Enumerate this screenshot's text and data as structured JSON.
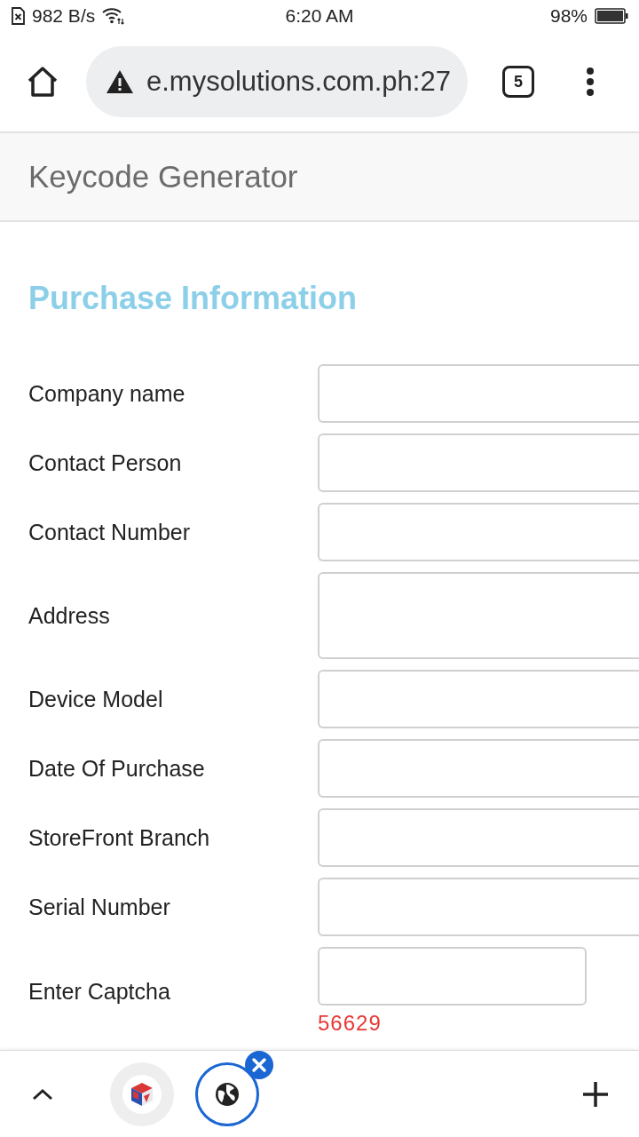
{
  "status_bar": {
    "network_speed": "982 B/s",
    "time": "6:20 AM",
    "battery": "98%"
  },
  "browser": {
    "url": "e.mysolutions.com.ph:27",
    "tab_count": "5"
  },
  "header": {
    "title": "Keycode Generator"
  },
  "form": {
    "heading": "Purchase Information",
    "fields": [
      {
        "label": "Company name",
        "kind": "text"
      },
      {
        "label": "Contact Person",
        "kind": "text"
      },
      {
        "label": "Contact Number",
        "kind": "text"
      },
      {
        "label": "Address",
        "kind": "textarea"
      },
      {
        "label": "Device Model",
        "kind": "text"
      },
      {
        "label": "Date Of Purchase",
        "kind": "text"
      },
      {
        "label": "StoreFront Branch",
        "kind": "text"
      },
      {
        "label": "Serial Number",
        "kind": "text"
      },
      {
        "label": "Enter Captcha",
        "kind": "captcha",
        "captcha": "56629"
      }
    ]
  },
  "bottom_bar": {
    "tabs": [
      {
        "kind": "favicon",
        "selected": false
      },
      {
        "kind": "default",
        "selected": true
      }
    ]
  }
}
